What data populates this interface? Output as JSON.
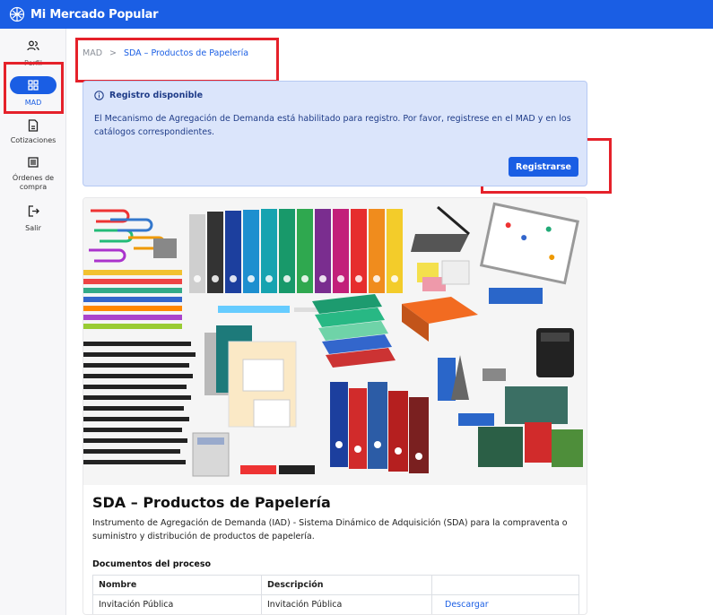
{
  "app": {
    "title": "Mi Mercado Popular"
  },
  "sidebar": {
    "items": [
      {
        "label": "Perfil"
      },
      {
        "label": "MAD"
      },
      {
        "label": "Cotizaciones"
      },
      {
        "label": "Órdenes de compra"
      },
      {
        "label": "Salir"
      }
    ]
  },
  "breadcrumb": {
    "root": "MAD",
    "separator": ">",
    "current": "SDA – Productos de Papelería"
  },
  "alert": {
    "title": "Registro disponible",
    "text": "El Mecanismo de Agregación de Demanda está habilitado para registro. Por favor, registrese en el MAD y en los catálogos correspondientes.",
    "button_label": "Registrarse"
  },
  "product": {
    "title": "SDA – Productos de Papelería",
    "description": "Instrumento de Agregación de Demanda (IAD) - Sistema Dinámico de Adquisición (SDA) para la compraventa o suministro y distribución de productos de papelería."
  },
  "documents": {
    "section_title": "Documentos del proceso",
    "headers": [
      "Nombre",
      "Descripción",
      ""
    ],
    "rows": [
      {
        "name": "Invitación Pública",
        "description": "Invitación Pública",
        "action": "Descargar"
      }
    ]
  },
  "colors": {
    "brand": "#1a5ee4",
    "highlight": "#e5212a",
    "alert_bg": "#dbe5fb"
  }
}
